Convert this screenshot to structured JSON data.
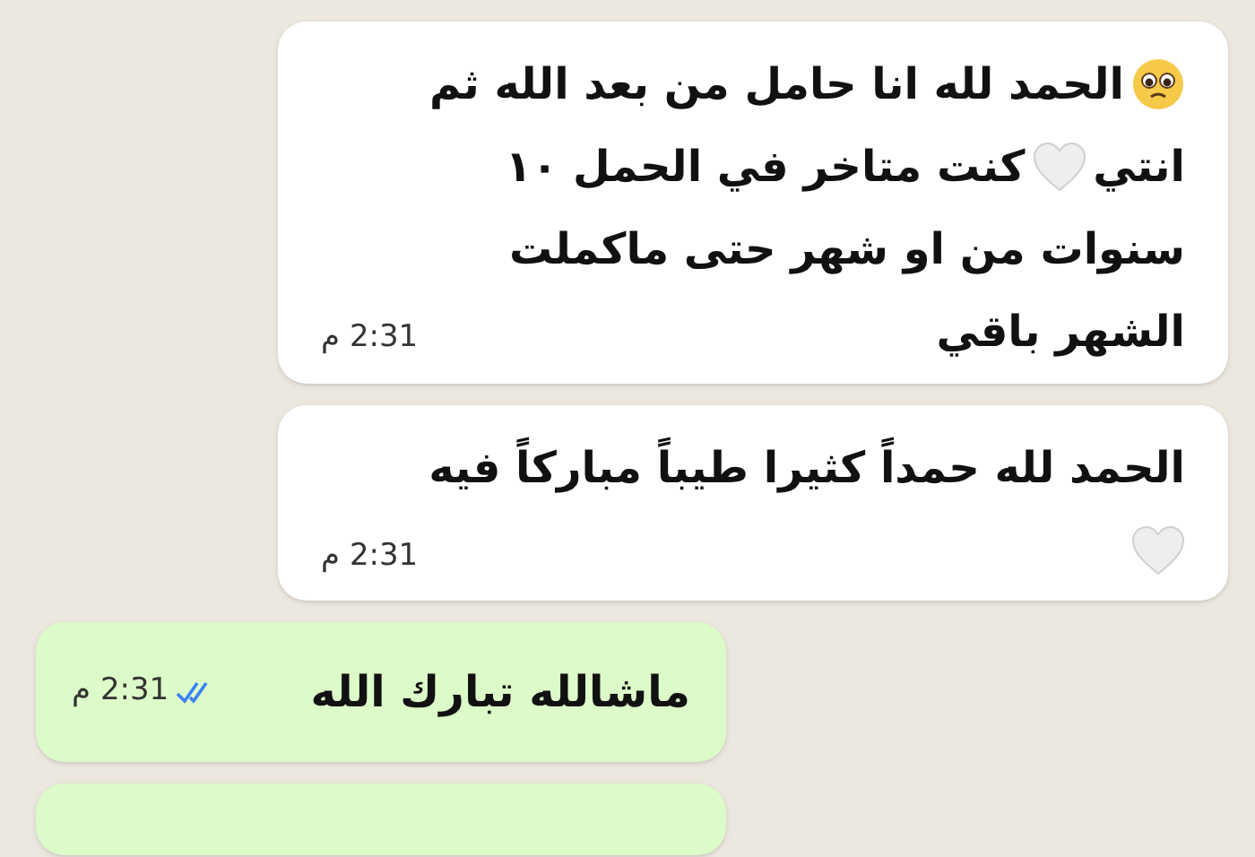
{
  "messages": [
    {
      "kind": "incoming",
      "lines": [
        [
          {
            "kind": "face"
          },
          {
            "kind": "text",
            "text": "الحمد لله انا حامل من بعد الله ثم"
          }
        ],
        [
          {
            "kind": "text",
            "text": "انتي"
          },
          {
            "kind": "heart"
          },
          {
            "kind": "text",
            "text": "كنت متاخر في الحمل ١٠"
          }
        ],
        [
          {
            "kind": "text",
            "text": "سنوات من او شهر حتى ماكملت"
          }
        ],
        [
          {
            "kind": "text",
            "text": "الشهر باقي"
          }
        ]
      ],
      "time": "2:31 م"
    },
    {
      "kind": "incoming",
      "lines": [
        [
          {
            "kind": "text",
            "text": "الحمد لله حمداً كثيرا طيباً مباركاً فيه"
          }
        ],
        [
          {
            "kind": "heart"
          }
        ]
      ],
      "time": "2:31 م"
    },
    {
      "kind": "outgoing",
      "lines": [
        [
          {
            "kind": "text",
            "text": "ماشالله تبارك الله"
          }
        ]
      ],
      "time": "2:31 م",
      "read": true
    },
    {
      "kind": "outgoing"
    }
  ]
}
